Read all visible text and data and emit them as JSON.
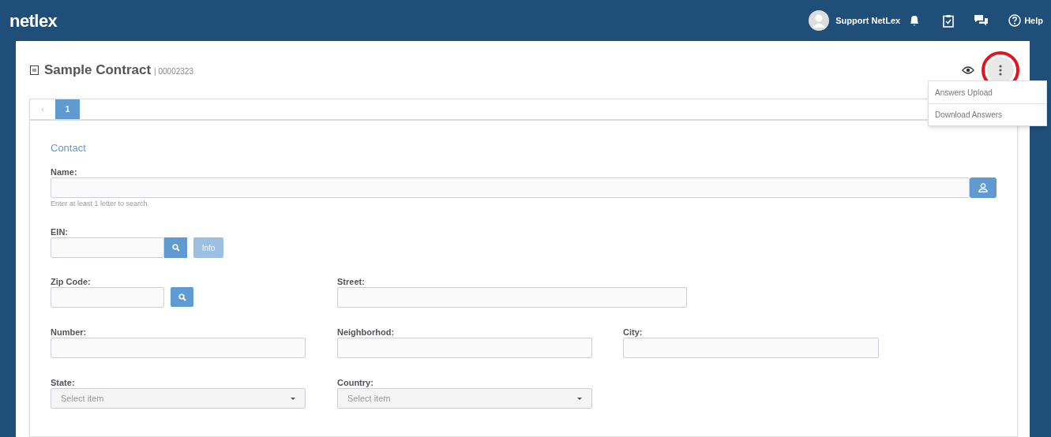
{
  "header": {
    "logo": "netlex",
    "user": "Support NetLex",
    "help": "Help"
  },
  "document": {
    "title": "Sample Contract",
    "number": "| 00002323"
  },
  "actions_menu": {
    "open": true,
    "highlighted": true,
    "items": [
      "Answers Upload",
      "Download Answers"
    ]
  },
  "pager": {
    "prev": "‹",
    "pages": [
      {
        "label": "1",
        "selected": true
      }
    ]
  },
  "section": "Contact",
  "name_field": {
    "label": "Name:",
    "hint": "Enter at least 1 letter to search."
  },
  "ein_field": {
    "label": "EIN:",
    "info_button": {
      "label": "Info",
      "disabled": true
    }
  },
  "zip_field": {
    "label": "Zip Code:"
  },
  "street_field": {
    "label": "Street:"
  },
  "number_field": {
    "label": "Number:"
  },
  "neighborhood_field": {
    "label": "Neighborhod:"
  },
  "city_field": {
    "label": "City:"
  },
  "state_field": {
    "label": "State:",
    "placeholder": "Select item"
  },
  "country_field": {
    "label": "Country:",
    "placeholder": "Select item"
  }
}
